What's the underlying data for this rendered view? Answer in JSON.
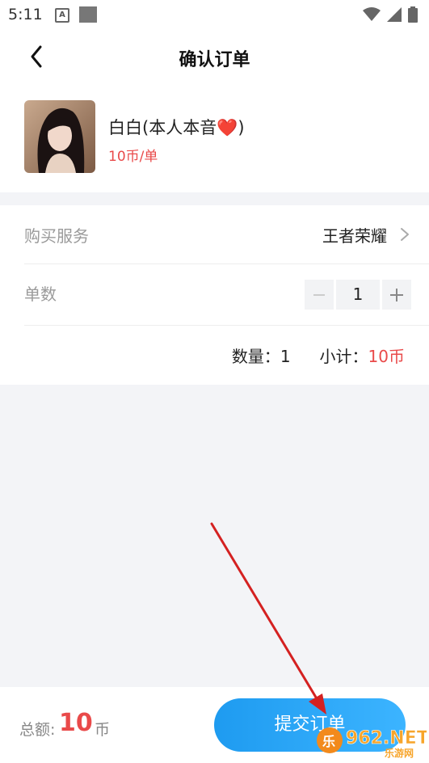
{
  "status_bar": {
    "time": "5:11"
  },
  "header": {
    "title": "确认订单"
  },
  "product": {
    "name": "白白(本人本音❤️)",
    "price": "10币/单"
  },
  "order": {
    "service_label": "购买服务",
    "service_value": "王者荣耀",
    "quantity_label": "单数",
    "quantity_value": "1",
    "minus": "−",
    "plus": "+",
    "summary_qty_label": "数量：",
    "summary_qty_value": "1",
    "summary_subtotal_label": "小计：",
    "summary_subtotal_value": "10币"
  },
  "footer": {
    "total_label": "总额:",
    "total_amount": "10",
    "total_unit": "币",
    "submit_label": "提交订单"
  },
  "watermark": {
    "text": "962.NET",
    "subtext": "乐游网"
  },
  "colors": {
    "accent_red": "#e94a4a",
    "button_blue": "#1e9bf0",
    "annotation_arrow": "#d42121"
  }
}
